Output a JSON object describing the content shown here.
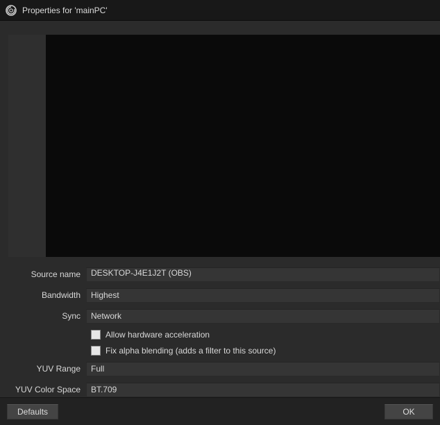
{
  "window": {
    "title": "Properties for 'mainPC'"
  },
  "form": {
    "source_name": {
      "label": "Source name",
      "value": "DESKTOP-J4E1J2T (OBS)"
    },
    "bandwidth": {
      "label": "Bandwidth",
      "value": "Highest"
    },
    "sync": {
      "label": "Sync",
      "value": "Network"
    },
    "hw_accel": {
      "label": "Allow hardware acceleration",
      "checked": false
    },
    "fix_alpha": {
      "label": "Fix alpha blending (adds a filter to this source)",
      "checked": false
    },
    "yuv_range": {
      "label": "YUV Range",
      "value": "Full"
    },
    "yuv_cs": {
      "label": "YUV Color Space",
      "value": "BT.709"
    }
  },
  "buttons": {
    "defaults": "Defaults",
    "ok": "OK"
  },
  "icons": {
    "app": "obs-icon"
  }
}
